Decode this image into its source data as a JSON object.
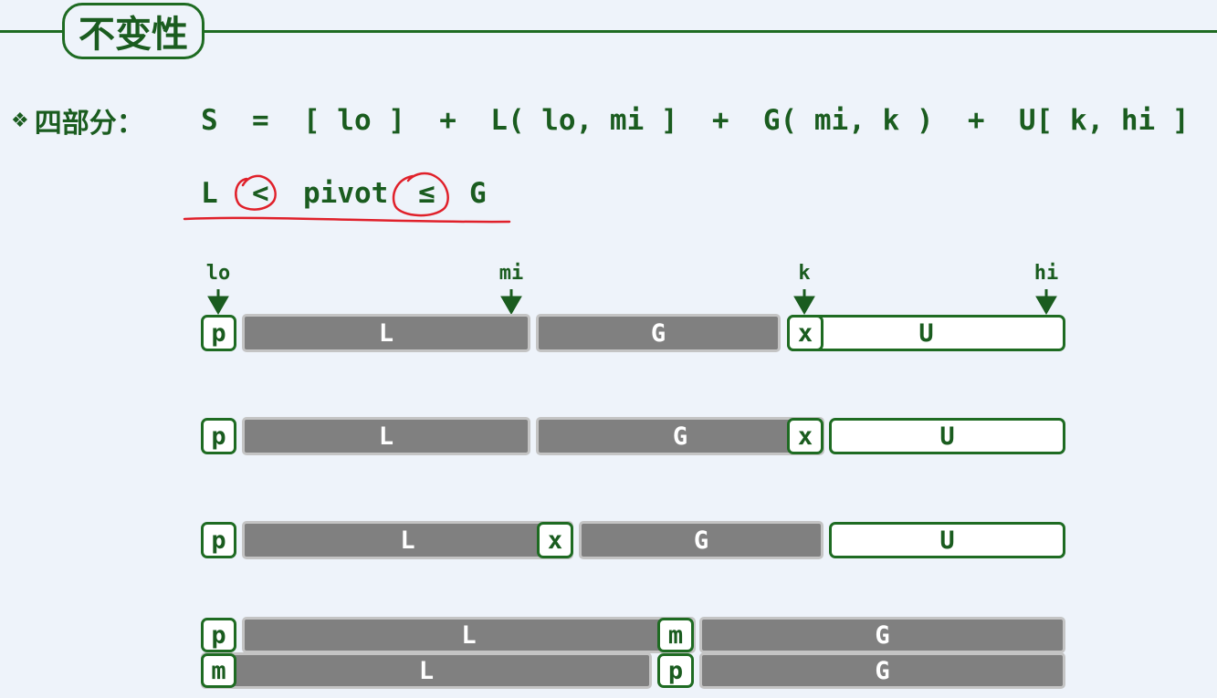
{
  "title": "不变性",
  "bullet": {
    "symbol": "❖",
    "label": "四部分："
  },
  "formula": "S  =  [ lo ]  +  L( lo, mi ]  +  G( mi, k )  +  U[ k, hi ]",
  "inequality": {
    "left": "L",
    "op1": "<",
    "middle": "pivot",
    "op2": "≤",
    "right": "G"
  },
  "markers": [
    "lo",
    "mi",
    "k",
    "hi"
  ],
  "rows": [
    [
      "p",
      "L",
      "G",
      "x",
      "U"
    ],
    [
      "p",
      "L",
      "G",
      "x",
      "U"
    ],
    [
      "p",
      "L",
      "x",
      "G",
      "U"
    ],
    [
      "p",
      "L",
      "m",
      "G"
    ],
    [
      "m",
      "L",
      "p",
      "G"
    ]
  ],
  "colors": {
    "green": "#1e6b22",
    "gray_fill": "#808080",
    "annotation_red": "#e0202a"
  }
}
